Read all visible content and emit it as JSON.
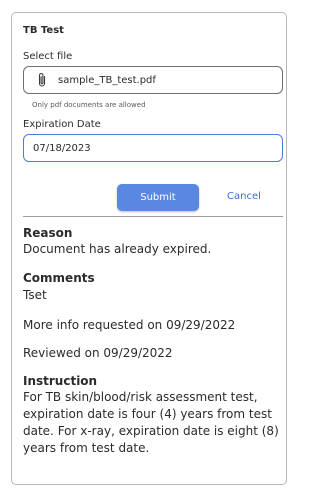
{
  "form": {
    "title": "TB Test",
    "select_file_label": "Select file",
    "file_name": "sample_TB_test.pdf",
    "file_hint": "Only pdf documents are allowed",
    "expiration_label": "Expiration Date",
    "expiration_value": "07/18/2023",
    "submit_label": "Submit",
    "cancel_label": "Cancel"
  },
  "details": {
    "reason_heading": "Reason",
    "reason_text": "Document has already expired.",
    "comments_heading": "Comments",
    "comments_text": "Tset",
    "more_info_text": "More info requested on 09/29/2022",
    "reviewed_text": "Reviewed on 09/29/2022",
    "instruction_heading": "Instruction",
    "instruction_text": "For TB skin/blood/risk assessment test, expiration date is four (4) years from test date. For x-ray, expiration date is eight (8) years from test date."
  },
  "icons": {
    "attachment": "paperclip-icon"
  },
  "colors": {
    "accent": "#5a88e0",
    "link": "#3b6fd1",
    "focus_border": "#4a7fd6"
  }
}
